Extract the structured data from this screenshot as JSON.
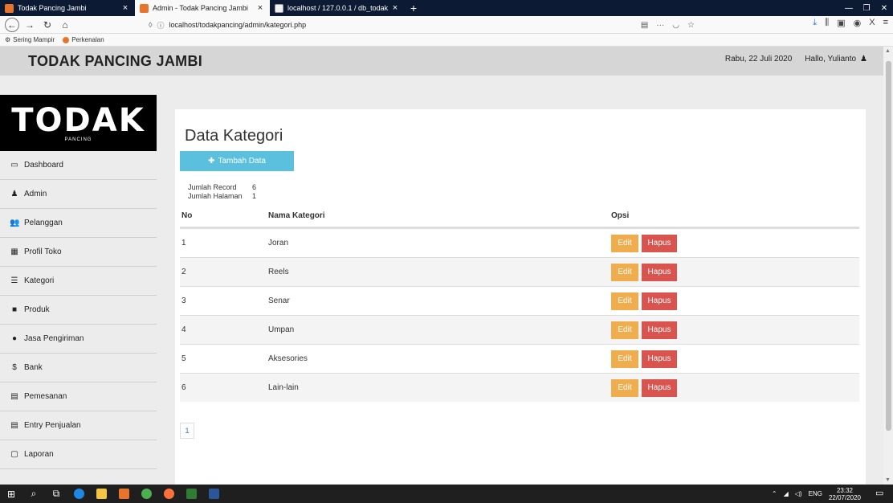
{
  "browser": {
    "tabs": [
      {
        "title": "Todak Pancing Jambi",
        "active": false
      },
      {
        "title": "Admin - Todak Pancing Jambi",
        "active": true
      },
      {
        "title": "localhost / 127.0.0.1 / db_todak",
        "active": false
      }
    ],
    "url": "localhost/todakpancing/admin/kategori.php",
    "bookmarks": [
      "Sering Mampir",
      "Perkenalan"
    ]
  },
  "header": {
    "title": "TODAK PANCING JAMBI",
    "date": "Rabu, 22 Juli 2020",
    "greeting": "Hallo, Yulianto"
  },
  "logo": {
    "big": "TODAK",
    "small": "PANCING"
  },
  "sidebar": {
    "items": [
      {
        "label": "Dashboard",
        "icon": "monitor-icon",
        "glyph": "▭"
      },
      {
        "label": "Admin",
        "icon": "user-icon",
        "glyph": "♟"
      },
      {
        "label": "Pelanggan",
        "icon": "users-icon",
        "glyph": "👥"
      },
      {
        "label": "Profil Toko",
        "icon": "table-icon",
        "glyph": "▦"
      },
      {
        "label": "Kategori",
        "icon": "list-icon",
        "glyph": "☰"
      },
      {
        "label": "Produk",
        "icon": "briefcase-icon",
        "glyph": "■"
      },
      {
        "label": "Jasa Pengiriman",
        "icon": "map-marker-icon",
        "glyph": "●"
      },
      {
        "label": "Bank",
        "icon": "dollar-icon",
        "glyph": "$"
      },
      {
        "label": "Pemesanan",
        "icon": "credit-card-icon",
        "glyph": "▤"
      },
      {
        "label": "Entry Penjualan",
        "icon": "credit-card-icon",
        "glyph": "▤"
      },
      {
        "label": "Laporan",
        "icon": "document-icon",
        "glyph": "▢"
      }
    ]
  },
  "main": {
    "title": "Data Kategori",
    "add_button": "Tambah Data",
    "jumlah_record_label": "Jumlah Record",
    "jumlah_record": "6",
    "jumlah_halaman_label": "Jumlah Halaman",
    "jumlah_halaman": "1",
    "columns": {
      "no": "No",
      "nama": "Nama Kategori",
      "opsi": "Opsi"
    },
    "rows": [
      {
        "no": "1",
        "nama": "Joran"
      },
      {
        "no": "2",
        "nama": "Reels"
      },
      {
        "no": "3",
        "nama": "Senar"
      },
      {
        "no": "4",
        "nama": "Umpan"
      },
      {
        "no": "5",
        "nama": "Aksesories"
      },
      {
        "no": "6",
        "nama": "Lain-lain"
      }
    ],
    "edit_label": "Edit",
    "delete_label": "Hapus",
    "page": "1"
  },
  "taskbar": {
    "lang": "ENG",
    "time": "23:32",
    "date": "22/07/2020"
  },
  "colors": {
    "info": "#5bc0de",
    "warning": "#f0ad4e",
    "danger": "#d9534f"
  }
}
